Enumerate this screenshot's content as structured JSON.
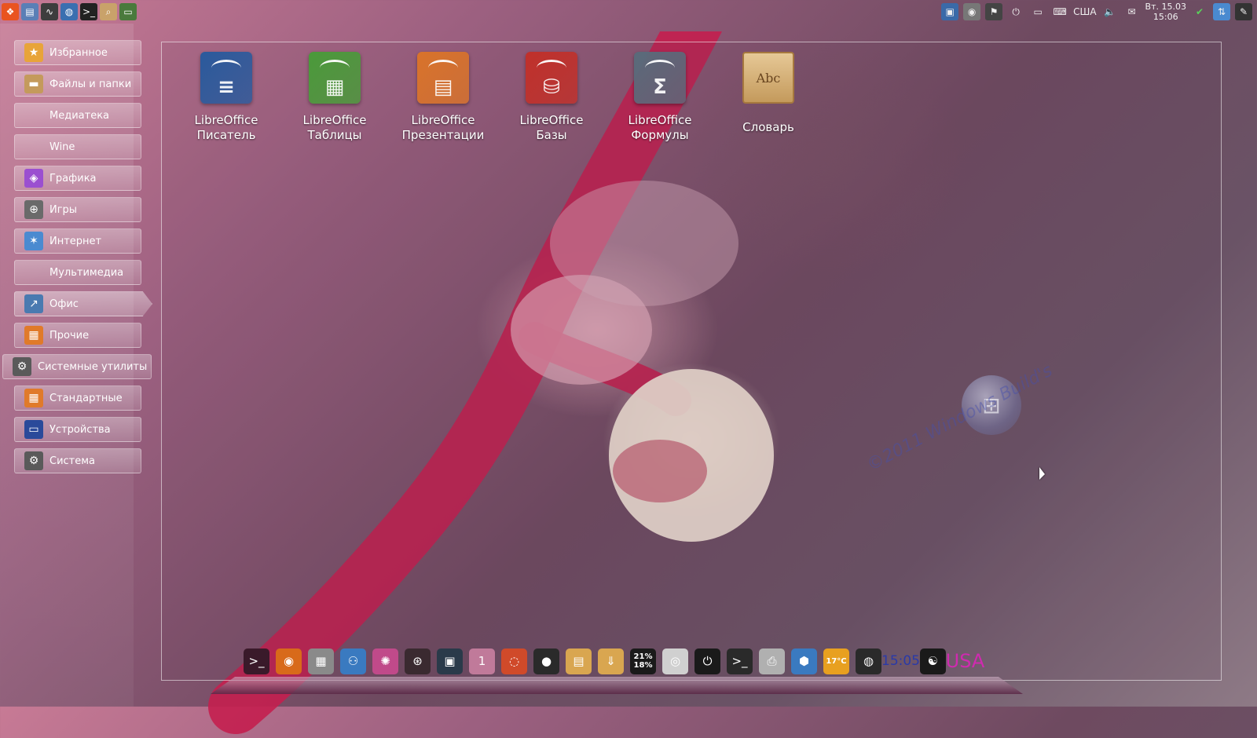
{
  "top_panel": {
    "launchers": [
      {
        "icon": "ubuntu-logo-icon",
        "color": "#e95420"
      },
      {
        "icon": "system-monitor-icon",
        "color": "#5a7fb6"
      },
      {
        "icon": "activity-graph-icon",
        "color": "#3d3d3d"
      },
      {
        "icon": "browser-globe-icon",
        "color": "#3a6fb0"
      },
      {
        "icon": "terminal-icon",
        "color": "#222222"
      },
      {
        "icon": "file-search-icon",
        "color": "#c9a26a"
      },
      {
        "icon": "display-settings-icon",
        "color": "#4a7a3c"
      }
    ],
    "tray": {
      "keyboard_layout": "США",
      "clock_line1": "Вт. 15.03",
      "clock_line2": "15:06"
    }
  },
  "categories": [
    {
      "label": "Избранное",
      "icon": "star-icon",
      "color": "#e8a43a"
    },
    {
      "label": "Файлы и папки",
      "icon": "folder-icon",
      "color": "#c49a5c"
    },
    {
      "label": "Медиатека",
      "icon": "",
      "color": ""
    },
    {
      "label": "Wine",
      "icon": "",
      "color": ""
    },
    {
      "label": "Графика",
      "icon": "palette-icon",
      "color": "#9b4fd0"
    },
    {
      "label": "Игры",
      "icon": "gamepad-icon",
      "color": "#6a6a6a"
    },
    {
      "label": "Интернет",
      "icon": "network-icon",
      "color": "#4a8ad0"
    },
    {
      "label": "Мультимедиа",
      "icon": "",
      "color": ""
    },
    {
      "label": "Офис",
      "icon": "office-chart-icon",
      "color": "#4a7ab0"
    },
    {
      "label": "Прочие",
      "icon": "misc-grid-icon",
      "color": "#e07a2a"
    },
    {
      "label": "Системные утилиты",
      "icon": "system-tools-icon",
      "color": "#5a5a5a"
    },
    {
      "label": "Стандартные",
      "icon": "accessories-icon",
      "color": "#e07a2a"
    },
    {
      "label": "Устройства",
      "icon": "monitor-icon",
      "color": "#2a4a9a"
    },
    {
      "label": "Система",
      "icon": "system-settings-icon",
      "color": "#5a5a5a"
    }
  ],
  "active_category": "Офис",
  "apps": [
    {
      "line1": "LibreOffice",
      "line2": "Писатель",
      "icon": "libreoffice-writer-icon",
      "color": "#2a5a9c",
      "glyph": "≡"
    },
    {
      "line1": "LibreOffice",
      "line2": "Таблицы",
      "icon": "libreoffice-calc-icon",
      "color": "#4a9a3a",
      "glyph": "▦"
    },
    {
      "line1": "LibreOffice",
      "line2": "Презентации",
      "icon": "libreoffice-impress-icon",
      "color": "#d9732a",
      "glyph": "▤"
    },
    {
      "line1": "LibreOffice",
      "line2": "Базы",
      "icon": "libreoffice-base-icon",
      "color": "#c0302a",
      "glyph": "⛁"
    },
    {
      "line1": "LibreOffice",
      "line2": "Формулы",
      "icon": "libreoffice-math-icon",
      "color": "#5a6a7a",
      "glyph": "Σ"
    },
    {
      "line1": "Словарь",
      "line2": "",
      "icon": "dictionary-book-icon",
      "color": "#d4b07a",
      "glyph": "Abc"
    }
  ],
  "watermark": "©2011 Windows Build's",
  "dock": {
    "items": [
      {
        "icon": "terminal-prompt-icon",
        "color": "#3a1a2a",
        "glyph": ">_"
      },
      {
        "icon": "firefox-icon",
        "color": "#d86a1a",
        "glyph": "◉"
      },
      {
        "icon": "calculator-icon",
        "color": "#8a8a8a",
        "glyph": "▦"
      },
      {
        "icon": "users-icon",
        "color": "#3a7ac0",
        "glyph": "⚇"
      },
      {
        "icon": "color-wheel-icon",
        "color": "#c04a8a",
        "glyph": "✺"
      },
      {
        "icon": "aperture-icon",
        "color": "#3a2a30",
        "glyph": "⊛"
      },
      {
        "icon": "window-switcher-icon",
        "color": "#2a3a4a",
        "glyph": "▣"
      },
      {
        "icon": "workspace-icon",
        "color": "#c07a9a",
        "glyph": "1"
      },
      {
        "icon": "ubuntu-ring-icon",
        "color": "#d04a2a",
        "glyph": "◌"
      },
      {
        "icon": "penguin-icon",
        "color": "#2a2a2a",
        "glyph": "●"
      },
      {
        "icon": "documents-folder-icon",
        "color": "#d9a650",
        "glyph": "▤"
      },
      {
        "icon": "downloads-folder-icon",
        "color": "#d9a650",
        "glyph": "⇓"
      },
      {
        "icon": "cpu-meter-icon",
        "color": "#1a1a1a",
        "glyph": "",
        "text": "21%\n18%"
      },
      {
        "icon": "disc-icon",
        "color": "#d0d0d0",
        "glyph": "◎"
      },
      {
        "icon": "power-icon",
        "color": "#1a1a1a",
        "glyph": "⏻"
      },
      {
        "icon": "console-icon",
        "color": "#2a2a2a",
        "glyph": ">_"
      },
      {
        "icon": "printer-icon",
        "color": "#b0b0b0",
        "glyph": "⎙"
      },
      {
        "icon": "package-box-icon",
        "color": "#3a7ac0",
        "glyph": "⬢"
      },
      {
        "icon": "weather-sun-icon",
        "color": "#e8a020",
        "glyph": "",
        "text": "17°C"
      },
      {
        "icon": "speaker-icon",
        "color": "#2a2a2a",
        "glyph": "◍"
      },
      {
        "icon": "digital-clock-icon",
        "color": "transparent",
        "glyph": "",
        "text": "15:05"
      },
      {
        "icon": "yin-yang-icon",
        "color": "#1a1a1a",
        "glyph": "☯"
      },
      {
        "icon": "keyboard-layout-icon",
        "color": "transparent",
        "glyph": "",
        "text": "USA"
      }
    ]
  }
}
